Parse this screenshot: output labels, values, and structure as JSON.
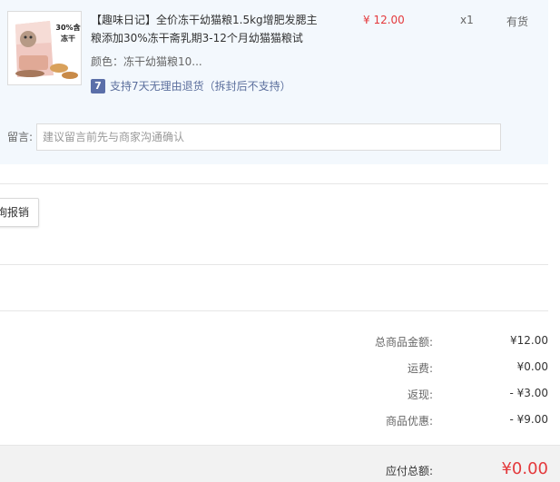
{
  "product": {
    "title": "【趣味日记】全价冻干幼猫粮1.5kg增肥发腮主粮添加30%冻干斋乳期3-12个月幼猫猫粮试",
    "price": "¥ 12.00",
    "quantity": "x1",
    "stock": "有货",
    "color_line": "颜色：冻干幼猫粮10...",
    "return_badge": "7",
    "return_text": "支持7天无理由退货（拆封后不支持）",
    "image_text": "30%含冻干",
    "image_icon": "cat-food-bag"
  },
  "note": {
    "label": "留言:",
    "placeholder": "建议留言前先与商家沟通确认"
  },
  "invoice": {
    "button_label": "询报销"
  },
  "summary": {
    "rows": [
      {
        "label": "总商品金额:",
        "value": "¥12.00"
      },
      {
        "label": "运费:",
        "value": "¥0.00"
      },
      {
        "label": "返现:",
        "value": "- ¥3.00"
      },
      {
        "label": "商品优惠:",
        "value": "- ¥9.00"
      }
    ],
    "total_label": "应付总额:",
    "total_value": "¥0.00"
  },
  "colors": {
    "accent_red": "#e4393c",
    "panel_blue": "#f3f8fd",
    "badge_blue": "#5b6fa9"
  }
}
